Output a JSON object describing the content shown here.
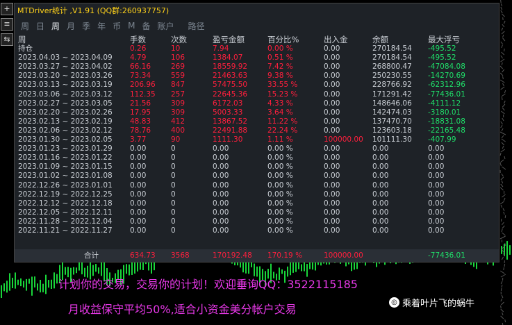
{
  "window": {
    "title": "MTDriver统计 ,V1.91 (QQ群:260937757)"
  },
  "left_toolbar": [
    "+",
    "≡",
    "⇆"
  ],
  "tabs": [
    {
      "label": "周",
      "active": false
    },
    {
      "label": "日",
      "active": false
    },
    {
      "label": "周",
      "active": true
    },
    {
      "label": "月",
      "active": false
    },
    {
      "label": "季",
      "active": false
    },
    {
      "label": "年",
      "active": false
    },
    {
      "label": "币",
      "active": false
    },
    {
      "label": "M",
      "active": false
    },
    {
      "label": "备",
      "active": false
    },
    {
      "label": "账户",
      "active": false
    },
    {
      "label": "路径",
      "active": false
    }
  ],
  "headers": [
    "周",
    "手数",
    "次数",
    "盈亏金额",
    "百分比%",
    "出入金",
    "余额",
    "最大浮亏"
  ],
  "rows": [
    {
      "period": "持仓",
      "lots": "0.26",
      "trades": "10",
      "pl": "7.94",
      "pct": "0.00 %",
      "deposit": "0.00",
      "balance": "270184.54",
      "dd": "-495.52",
      "profit": true
    },
    {
      "period": "2023.04.03 ~ 2023.04.09",
      "lots": "4.79",
      "trades": "106",
      "pl": "1384.07",
      "pct": "0.51 %",
      "deposit": "0.00",
      "balance": "270184.54",
      "dd": "-495.52",
      "profit": true
    },
    {
      "period": "2023.03.27 ~ 2023.04.02",
      "lots": "66.16",
      "trades": "269",
      "pl": "18559.92",
      "pct": "7.42 %",
      "deposit": "0.00",
      "balance": "268800.47",
      "dd": "-47084.08",
      "profit": true
    },
    {
      "period": "2023.03.20 ~ 2023.03.26",
      "lots": "73.34",
      "trades": "559",
      "pl": "21463.63",
      "pct": "9.38 %",
      "deposit": "0.00",
      "balance": "250230.55",
      "dd": "-14270.69",
      "profit": true
    },
    {
      "period": "2023.03.13 ~ 2023.03.19",
      "lots": "206.96",
      "trades": "847",
      "pl": "57475.50",
      "pct": "33.55 %",
      "deposit": "0.00",
      "balance": "228766.92",
      "dd": "-62312.96",
      "profit": true
    },
    {
      "period": "2023.03.06 ~ 2023.03.12",
      "lots": "112.35",
      "trades": "257",
      "pl": "22645.36",
      "pct": "15.23 %",
      "deposit": "0.00",
      "balance": "171291.42",
      "dd": "-77436.01",
      "profit": true
    },
    {
      "period": "2023.02.27 ~ 2023.03.05",
      "lots": "21.56",
      "trades": "309",
      "pl": "6172.03",
      "pct": "4.33 %",
      "deposit": "0.00",
      "balance": "148646.06",
      "dd": "-4111.12",
      "profit": true
    },
    {
      "period": "2023.02.20 ~ 2023.02.26",
      "lots": "17.95",
      "trades": "309",
      "pl": "5003.33",
      "pct": "3.64 %",
      "deposit": "0.00",
      "balance": "142474.03",
      "dd": "-3180.01",
      "profit": true
    },
    {
      "period": "2023.02.13 ~ 2023.02.19",
      "lots": "48.83",
      "trades": "412",
      "pl": "13867.52",
      "pct": "11.22 %",
      "deposit": "0.00",
      "balance": "137470.70",
      "dd": "-18831.08",
      "profit": true
    },
    {
      "period": "2023.02.06 ~ 2023.02.12",
      "lots": "78.76",
      "trades": "400",
      "pl": "22491.88",
      "pct": "22.24 %",
      "deposit": "0.00",
      "balance": "123603.18",
      "dd": "-22165.48",
      "profit": true
    },
    {
      "period": "2023.01.30 ~ 2023.02.05",
      "lots": "3.77",
      "trades": "90",
      "pl": "1111.30",
      "pct": "1.11 %",
      "deposit": "100000.00",
      "balance": "101111.30",
      "dd": "-407.99",
      "profit": true,
      "deposit_red": true
    },
    {
      "period": "2023.01.23 ~ 2023.01.29",
      "lots": "0.00",
      "trades": "0",
      "pl": "0.00",
      "pct": "0.00 %",
      "deposit": "0.00",
      "balance": "0.00",
      "dd": "0.00",
      "profit": false
    },
    {
      "period": "2023.01.16 ~ 2023.01.22",
      "lots": "0.00",
      "trades": "0",
      "pl": "0.00",
      "pct": "0.00 %",
      "deposit": "0.00",
      "balance": "0.00",
      "dd": "0.00",
      "profit": false
    },
    {
      "period": "2023.01.09 ~ 2023.01.15",
      "lots": "0.00",
      "trades": "0",
      "pl": "0.00",
      "pct": "0.00 %",
      "deposit": "0.00",
      "balance": "0.00",
      "dd": "0.00",
      "profit": false
    },
    {
      "period": "2023.01.02 ~ 2023.01.08",
      "lots": "0.00",
      "trades": "0",
      "pl": "0.00",
      "pct": "0.00 %",
      "deposit": "0.00",
      "balance": "0.00",
      "dd": "0.00",
      "profit": false
    },
    {
      "period": "2022.12.26 ~ 2023.01.01",
      "lots": "0.00",
      "trades": "0",
      "pl": "0.00",
      "pct": "0.00 %",
      "deposit": "0.00",
      "balance": "0.00",
      "dd": "0.00",
      "profit": false
    },
    {
      "period": "2022.12.19 ~ 2022.12.25",
      "lots": "0.00",
      "trades": "0",
      "pl": "0.00",
      "pct": "0.00 %",
      "deposit": "0.00",
      "balance": "0.00",
      "dd": "0.00",
      "profit": false
    },
    {
      "period": "2022.12.12 ~ 2022.12.18",
      "lots": "0.00",
      "trades": "0",
      "pl": "0.00",
      "pct": "0.00 %",
      "deposit": "0.00",
      "balance": "0.00",
      "dd": "0.00",
      "profit": false
    },
    {
      "period": "2022.12.05 ~ 2022.12.11",
      "lots": "0.00",
      "trades": "0",
      "pl": "0.00",
      "pct": "0.00 %",
      "deposit": "0.00",
      "balance": "0.00",
      "dd": "0.00",
      "profit": false
    },
    {
      "period": "2022.11.28 ~ 2022.12.04",
      "lots": "0.00",
      "trades": "0",
      "pl": "0.00",
      "pct": "0.00 %",
      "deposit": "0.00",
      "balance": "0.00",
      "dd": "0.00",
      "profit": false
    },
    {
      "period": "2022.11.21 ~ 2022.11.27",
      "lots": "0.00",
      "trades": "0",
      "pl": "0.00",
      "pct": "0.00 %",
      "deposit": "0.00",
      "balance": "0.00",
      "dd": "0.00",
      "profit": false
    }
  ],
  "totals": {
    "label": "合计",
    "lots": "634.73",
    "trades": "3568",
    "pl": "170192.48",
    "pct": "170.19 %",
    "deposit": "100000.00",
    "dd": "-77436.01"
  },
  "ads": {
    "line1": "计划你的交易，交易你的计划！欢迎垂询QQ：3522115185",
    "line2": "月收益保守平均50%,适合小资金美分帐户交易"
  },
  "watermark": "乘着叶片飞的蜗牛",
  "colors": {
    "profit": "#ff1f3d",
    "neutral": "#c9ced4",
    "drawdown": "#1fe06a",
    "title": "#ffd21a",
    "ad": "#e838e8"
  }
}
